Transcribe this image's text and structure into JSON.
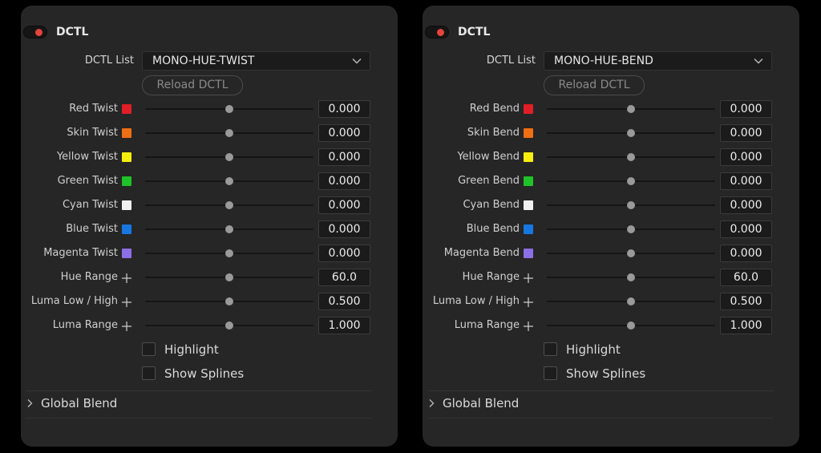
{
  "colors": {
    "background": "#000000",
    "panel": "#262626",
    "toggle_on": "#e5443c",
    "field": "#1b1b1b"
  },
  "panels": [
    {
      "title": "DCTL",
      "list_label": "DCTL List",
      "list_value": "MONO-HUE-TWIST",
      "reload_label": "Reload DCTL",
      "rows": [
        {
          "label": "Red Twist",
          "marker": "swatch",
          "color": "#e01e26",
          "value": "0.000",
          "level": 0.5
        },
        {
          "label": "Skin Twist",
          "marker": "swatch",
          "color": "#f06e14",
          "value": "0.000",
          "level": 0.5
        },
        {
          "label": "Yellow Twist",
          "marker": "swatch",
          "color": "#f7ee0f",
          "value": "0.000",
          "level": 0.5
        },
        {
          "label": "Green Twist",
          "marker": "swatch",
          "color": "#1fc228",
          "value": "0.000",
          "level": 0.5
        },
        {
          "label": "Cyan Twist",
          "marker": "swatch",
          "color": "#f0f0f0",
          "value": "0.000",
          "level": 0.5
        },
        {
          "label": "Blue Twist",
          "marker": "swatch",
          "color": "#1677e0",
          "value": "0.000",
          "level": 0.5
        },
        {
          "label": "Magenta Twist",
          "marker": "swatch",
          "color": "#8c6ee6",
          "value": "0.000",
          "level": 0.5
        },
        {
          "label": "Hue Range",
          "marker": "plus-icon",
          "color": "#d0d0d0",
          "value": "60.0",
          "level": 0.5
        },
        {
          "label": "Luma Low / High",
          "marker": "plus-icon",
          "color": "#d0d0d0",
          "value": "0.500",
          "level": 0.5
        },
        {
          "label": "Luma Range",
          "marker": "plus-icon",
          "color": "#d0d0d0",
          "value": "1.000",
          "level": 0.5
        }
      ],
      "checkboxes": [
        {
          "label": "Highlight",
          "checked": false
        },
        {
          "label": "Show Splines",
          "checked": false
        }
      ],
      "section_label": "Global Blend"
    },
    {
      "title": "DCTL",
      "list_label": "DCTL List",
      "list_value": "MONO-HUE-BEND",
      "reload_label": "Reload DCTL",
      "rows": [
        {
          "label": "Red Bend",
          "marker": "swatch",
          "color": "#e01e26",
          "value": "0.000",
          "level": 0.5
        },
        {
          "label": "Skin Bend",
          "marker": "swatch",
          "color": "#f06e14",
          "value": "0.000",
          "level": 0.5
        },
        {
          "label": "Yellow Bend",
          "marker": "swatch",
          "color": "#f7ee0f",
          "value": "0.000",
          "level": 0.5
        },
        {
          "label": "Green Bend",
          "marker": "swatch",
          "color": "#1fc228",
          "value": "0.000",
          "level": 0.5
        },
        {
          "label": "Cyan Bend",
          "marker": "swatch",
          "color": "#f0f0f0",
          "value": "0.000",
          "level": 0.5
        },
        {
          "label": "Blue Bend",
          "marker": "swatch",
          "color": "#1677e0",
          "value": "0.000",
          "level": 0.5
        },
        {
          "label": "Magenta Bend",
          "marker": "swatch",
          "color": "#8c6ee6",
          "value": "0.000",
          "level": 0.5
        },
        {
          "label": "Hue Range",
          "marker": "plus-icon",
          "color": "#d0d0d0",
          "value": "60.0",
          "level": 0.5
        },
        {
          "label": "Luma Low / High",
          "marker": "plus-icon",
          "color": "#d0d0d0",
          "value": "0.500",
          "level": 0.5
        },
        {
          "label": "Luma Range",
          "marker": "plus-icon",
          "color": "#d0d0d0",
          "value": "1.000",
          "level": 0.5
        }
      ],
      "checkboxes": [
        {
          "label": "Highlight",
          "checked": false
        },
        {
          "label": "Show Splines",
          "checked": false
        }
      ],
      "section_label": "Global Blend"
    }
  ]
}
